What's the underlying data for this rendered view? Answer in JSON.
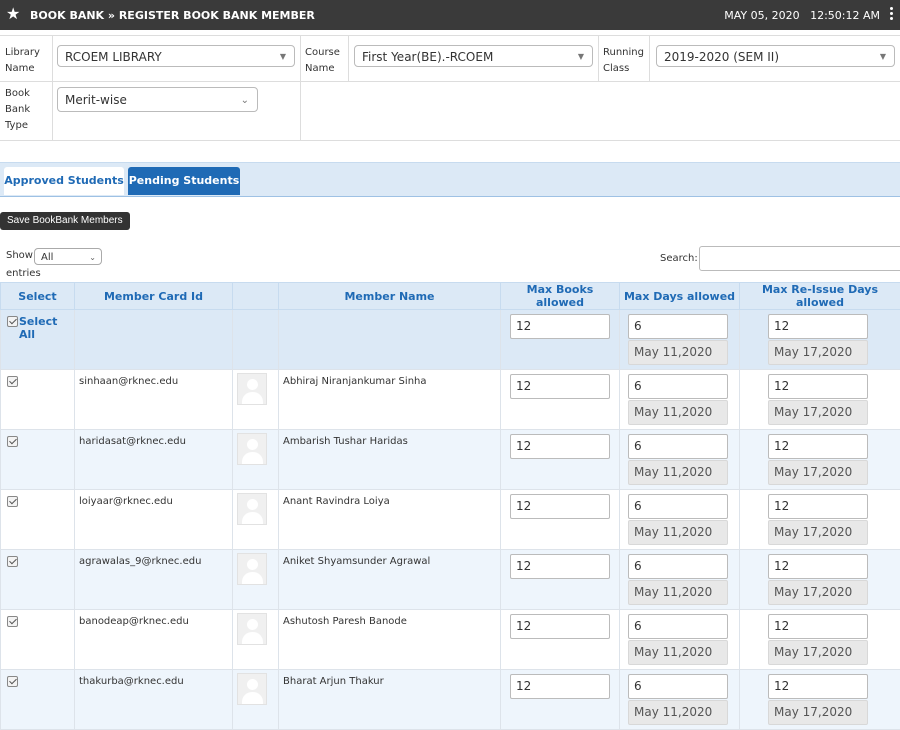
{
  "header": {
    "title": "BOOK BANK » REGISTER BOOK BANK MEMBER",
    "date": "MAY 05, 2020",
    "time": "12:50:12 AM"
  },
  "filters": {
    "library_label": "Library Name",
    "library_value": "RCOEM LIBRARY",
    "course_label": "Course Name",
    "course_value": "First Year(BE).-RCOEM",
    "running_label": "Running Class",
    "running_value": "2019-2020 (SEM II)",
    "booktype_label": "Book Bank Type",
    "booktype_value": "Merit-wise"
  },
  "tabs": {
    "approved": "Approved Students",
    "pending": "Pending Students"
  },
  "save_button": "Save BookBank Members",
  "show": {
    "label": "Show",
    "value": "All",
    "entries": "entries"
  },
  "search": {
    "label": "Search:"
  },
  "table": {
    "headers": {
      "select": "Select",
      "card_id": "Member Card Id",
      "name": "Member Name",
      "max_books": "Max Books allowed",
      "max_days": "Max Days allowed",
      "max_reissue": "Max Re-Issue Days allowed"
    },
    "select_all": {
      "label": "Select All",
      "max_books": "12",
      "max_days": "6",
      "days_date": "May 11,2020",
      "reissue": "12",
      "reissue_date": "May 17,2020"
    },
    "rows": [
      {
        "card_id": "sinhaan@rknec.edu",
        "name": "Abhiraj Niranjankumar Sinha",
        "max_books": "12",
        "max_days": "6",
        "days_date": "May 11,2020",
        "reissue": "12",
        "reissue_date": "May 17,2020"
      },
      {
        "card_id": "haridasat@rknec.edu",
        "name": "Ambarish Tushar Haridas",
        "max_books": "12",
        "max_days": "6",
        "days_date": "May 11,2020",
        "reissue": "12",
        "reissue_date": "May 17,2020"
      },
      {
        "card_id": "loiyaar@rknec.edu",
        "name": "Anant Ravindra Loiya",
        "max_books": "12",
        "max_days": "6",
        "days_date": "May 11,2020",
        "reissue": "12",
        "reissue_date": "May 17,2020"
      },
      {
        "card_id": "agrawalas_9@rknec.edu",
        "name": "Aniket Shyamsunder Agrawal",
        "max_books": "12",
        "max_days": "6",
        "days_date": "May 11,2020",
        "reissue": "12",
        "reissue_date": "May 17,2020"
      },
      {
        "card_id": "banodeap@rknec.edu",
        "name": "Ashutosh Paresh Banode",
        "max_books": "12",
        "max_days": "6",
        "days_date": "May 11,2020",
        "reissue": "12",
        "reissue_date": "May 17,2020"
      },
      {
        "card_id": "thakurba@rknec.edu",
        "name": "Bharat Arjun Thakur",
        "max_books": "12",
        "max_days": "6",
        "days_date": "May 11,2020",
        "reissue": "12",
        "reissue_date": "May 17,2020"
      }
    ]
  }
}
